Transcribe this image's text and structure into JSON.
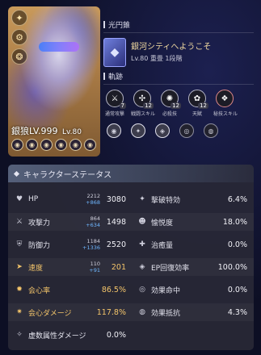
{
  "character": {
    "name": "銀狼",
    "level_text": "LV.999",
    "lv_label": "Lv.80",
    "side_icons": [
      "✦",
      "⚙",
      "❂"
    ],
    "trace_icons": [
      "◉",
      "◉",
      "◉",
      "◉",
      "◉",
      "◉"
    ]
  },
  "light_cone": {
    "section_title": "光円錐",
    "name": "銀河シティへようこそ",
    "level": "Lv.80",
    "superimpose": "重畳 1段階"
  },
  "traces": {
    "section_title": "軌跡",
    "skills": [
      {
        "label": "通常攻撃",
        "level": "7"
      },
      {
        "label": "戦闘スキル",
        "level": "12"
      },
      {
        "label": "必殺技",
        "level": "12"
      },
      {
        "label": "天賦",
        "level": "12"
      },
      {
        "label": "秘技スキル",
        "level": ""
      }
    ]
  },
  "stats_panel": {
    "title": "キャラクターステータス",
    "left": [
      {
        "icon": "heart-icon",
        "glyph": "♥",
        "name": "HP",
        "base": "2212",
        "bonus": "+868",
        "value": "3080",
        "gold": false
      },
      {
        "icon": "sword-icon",
        "glyph": "⚔",
        "name": "攻撃力",
        "base": "864",
        "bonus": "+634",
        "value": "1498",
        "gold": false
      },
      {
        "icon": "shield-icon",
        "glyph": "⛨",
        "name": "防御力",
        "base": "1184",
        "bonus": "+1336",
        "value": "2520",
        "gold": false
      },
      {
        "icon": "boot-icon",
        "glyph": "➤",
        "name": "速度",
        "base": "110",
        "bonus": "+91",
        "value": "201",
        "gold": true
      },
      {
        "icon": "crit-rate-icon",
        "glyph": "✹",
        "name": "会心率",
        "base": "",
        "bonus": "",
        "value": "86.5%",
        "gold": true
      },
      {
        "icon": "crit-dmg-icon",
        "glyph": "✷",
        "name": "会心ダメージ",
        "base": "",
        "bonus": "",
        "value": "117.8%",
        "gold": true
      },
      {
        "icon": "quantum-icon",
        "glyph": "✧",
        "name": "虚数属性ダメージ",
        "base": "",
        "bonus": "",
        "value": "0.0%",
        "gold": false
      }
    ],
    "right": [
      {
        "icon": "break-icon",
        "glyph": "✦",
        "name": "撃破特効",
        "value": "6.4%"
      },
      {
        "icon": "mask-icon",
        "glyph": "☻",
        "name": "愉悦度",
        "value": "18.0%"
      },
      {
        "icon": "heal-icon",
        "glyph": "✚",
        "name": "治癒量",
        "value": "0.0%"
      },
      {
        "icon": "energy-icon",
        "glyph": "◈",
        "name": "EP回復効率",
        "value": "100.0%"
      },
      {
        "icon": "effect-hit-icon",
        "glyph": "◎",
        "name": "効果命中",
        "value": "0.0%"
      },
      {
        "icon": "effect-res-icon",
        "glyph": "◍",
        "name": "効果抵抗",
        "value": "4.3%"
      }
    ]
  }
}
